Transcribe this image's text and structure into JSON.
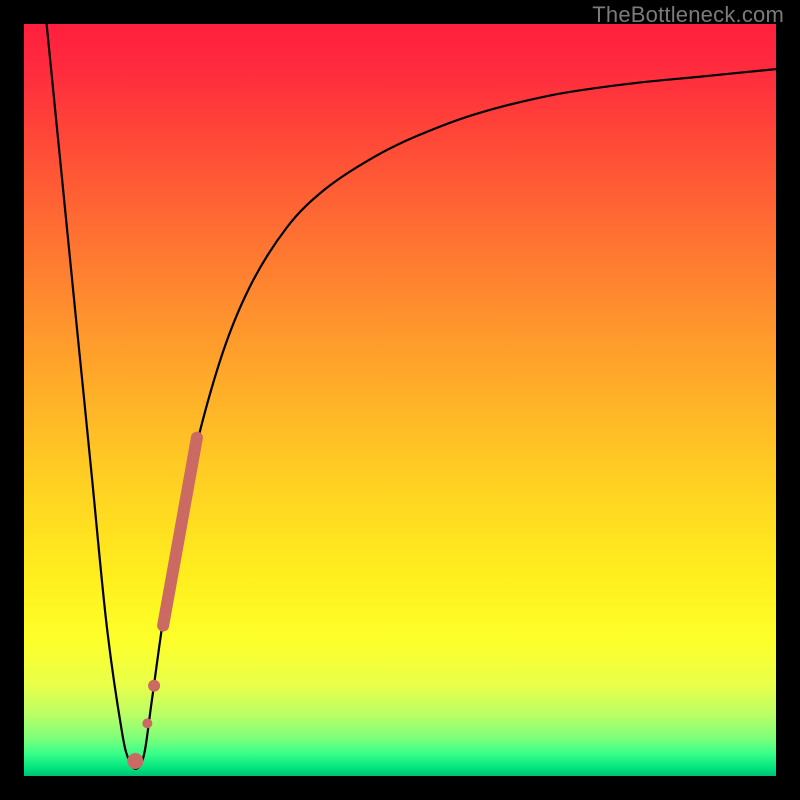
{
  "attribution": "TheBottleneck.com",
  "chart_data": {
    "type": "line",
    "title": "",
    "xlabel": "",
    "ylabel": "",
    "xlim": [
      0,
      100
    ],
    "ylim": [
      0,
      100
    ],
    "series": [
      {
        "name": "bottleneck-curve",
        "x": [
          3,
          5,
          7,
          9,
          11,
          13,
          14,
          15,
          16,
          17,
          19,
          22,
          26,
          30,
          35,
          40,
          46,
          52,
          60,
          70,
          80,
          90,
          100
        ],
        "values": [
          100,
          80,
          60,
          40,
          20,
          6,
          2,
          1,
          3,
          10,
          24,
          40,
          55,
          65,
          73,
          78,
          82,
          85,
          88,
          90.5,
          92,
          93,
          94
        ]
      }
    ],
    "markers": [
      {
        "name": "highlight-segment",
        "x": [
          18.5,
          23.0
        ],
        "y": [
          20,
          45
        ],
        "width": 12
      },
      {
        "name": "highlight-dot-1",
        "x": 17.3,
        "y": 12,
        "r": 6
      },
      {
        "name": "highlight-dot-2",
        "x": 16.4,
        "y": 7,
        "r": 5
      },
      {
        "name": "highlight-dot-3",
        "x": 14.8,
        "y": 2,
        "r": 8
      }
    ],
    "highlight_color": "#cb6a62"
  }
}
